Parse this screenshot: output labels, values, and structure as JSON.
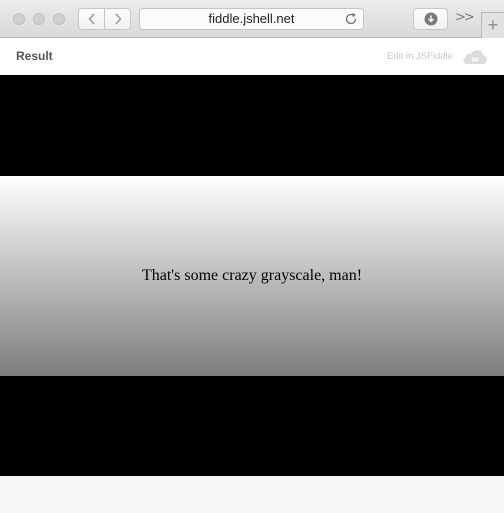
{
  "browser": {
    "url": "fiddle.jshell.net",
    "new_tab_label": "+",
    "overflow_label": ">>"
  },
  "fiddle": {
    "result_label": "Result",
    "edit_link": "Edit in JSFiddle"
  },
  "content": {
    "message": "That's some crazy grayscale, man!",
    "colors": {
      "background": "#000000",
      "gradient_top": "#ffffff",
      "gradient_bottom": "#7d7d7d"
    }
  },
  "icons": [
    "back-icon",
    "forward-icon",
    "reload-icon",
    "download-icon",
    "cloud-icon"
  ]
}
